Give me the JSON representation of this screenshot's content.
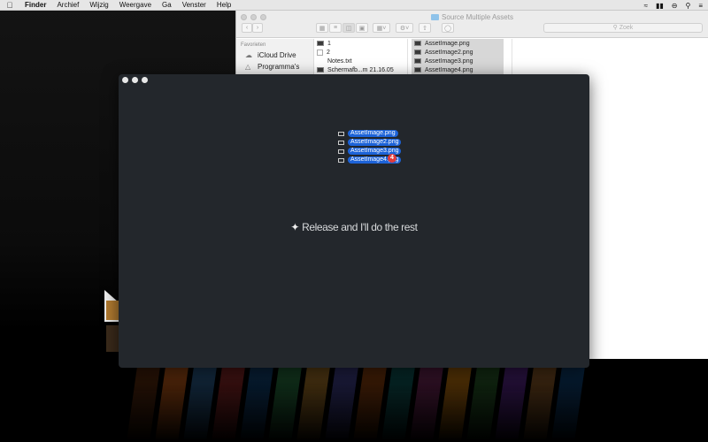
{
  "menubar": {
    "apple_icon": "apple-logo",
    "items": [
      "Finder",
      "Archief",
      "Wijzig",
      "Weergave",
      "Ga",
      "Venster",
      "Help"
    ],
    "status_icons": [
      "wifi-icon",
      "battery-icon",
      "do-not-disturb-icon",
      "search-icon",
      "menu-list-icon"
    ]
  },
  "finder": {
    "title": "Source Multiple Assets",
    "search_placeholder": "Zoek",
    "sidebar": {
      "heading": "Favorieten",
      "items": [
        {
          "label": "iCloud Drive",
          "icon": "cloud-icon"
        },
        {
          "label": "Programma's",
          "icon": "apps-icon"
        }
      ]
    },
    "column1": [
      "1",
      "2",
      "Notes.txt",
      "Schermafb...m 21.16.05"
    ],
    "column2": [
      "AssetImage.png",
      "AssetImage2.png",
      "AssetImage3.png",
      "AssetImage4.png"
    ]
  },
  "drop_window": {
    "dragged_files": [
      "AssetImage.png",
      "AssetImage2.png",
      "AssetImage3.png",
      "AssetImage4.png"
    ],
    "count_badge": "4",
    "message": "Release and I'll do the rest",
    "message_icon": "magic-wand-icon",
    "accent_color": "#1d63d8",
    "badge_color": "#e23b3b"
  }
}
